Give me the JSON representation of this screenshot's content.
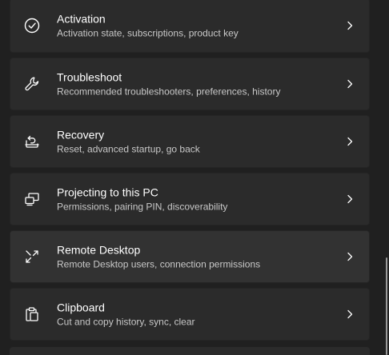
{
  "settings": {
    "items": [
      {
        "icon": "activation-check-icon",
        "title": "Activation",
        "subtitle": "Activation state, subscriptions, product key"
      },
      {
        "icon": "wrench-icon",
        "title": "Troubleshoot",
        "subtitle": "Recommended troubleshooters, preferences, history"
      },
      {
        "icon": "recovery-icon",
        "title": "Recovery",
        "subtitle": "Reset, advanced startup, go back"
      },
      {
        "icon": "projecting-icon",
        "title": "Projecting to this PC",
        "subtitle": "Permissions, pairing PIN, discoverability"
      },
      {
        "icon": "remote-desktop-icon",
        "title": "Remote Desktop",
        "subtitle": "Remote Desktop users, connection permissions"
      },
      {
        "icon": "clipboard-icon",
        "title": "Clipboard",
        "subtitle": "Cut and copy history, sync, clear"
      }
    ],
    "chevron_icon": "chevron-right-icon"
  },
  "colors": {
    "background": "#202020",
    "card": "#2b2b2b",
    "card_hover": "#323232",
    "title_text": "#ffffff",
    "subtitle_text": "#c8c8c8"
  }
}
